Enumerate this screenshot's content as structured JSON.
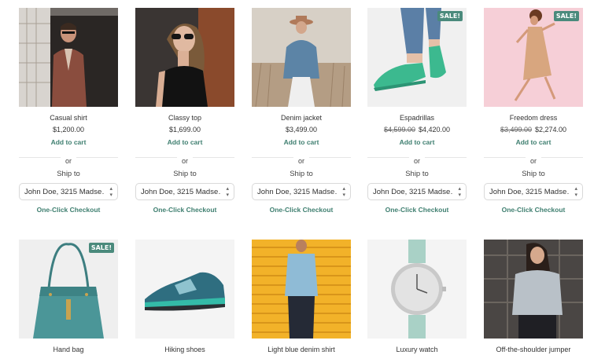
{
  "products": [
    {
      "title": "Casual shirt",
      "price": "$1,200.00",
      "old_price": "",
      "sale": false,
      "add_to_cart": "Add to cart",
      "or": "or",
      "ship_to": "Ship to",
      "address": "John Doe, 3215 Madse…",
      "checkout": "One-Click Checkout"
    },
    {
      "title": "Classy top",
      "price": "$1,699.00",
      "old_price": "",
      "sale": false,
      "add_to_cart": "Add to cart",
      "or": "or",
      "ship_to": "Ship to",
      "address": "John Doe, 3215 Madse…",
      "checkout": "One-Click Checkout"
    },
    {
      "title": "Denim jacket",
      "price": "$3,499.00",
      "old_price": "",
      "sale": false,
      "add_to_cart": "Add to cart",
      "or": "or",
      "ship_to": "Ship to",
      "address": "John Doe, 3215 Madse…",
      "checkout": "One-Click Checkout"
    },
    {
      "title": "Espadrillas",
      "price": "$4,420.00",
      "old_price": "$4,599.00",
      "sale": true,
      "sale_label": "SALE!",
      "add_to_cart": "Add to cart",
      "or": "or",
      "ship_to": "Ship to",
      "address": "John Doe, 3215 Madse…",
      "checkout": "One-Click Checkout"
    },
    {
      "title": "Freedom dress",
      "price": "$2,274.00",
      "old_price": "$3,499.00",
      "sale": true,
      "sale_label": "SALE!",
      "add_to_cart": "Add to cart",
      "or": "or",
      "ship_to": "Ship to",
      "address": "John Doe, 3215 Madse…",
      "checkout": "One-Click Checkout"
    }
  ],
  "products_row2": [
    {
      "title": "Hand bag",
      "sale": true,
      "sale_label": "SALE!"
    },
    {
      "title": "Hiking shoes",
      "sale": false
    },
    {
      "title": "Light blue denim shirt",
      "sale": false
    },
    {
      "title": "Luxury watch",
      "sale": false
    },
    {
      "title": "Off-the-shoulder jumper",
      "sale": false
    }
  ],
  "colors": {
    "accent": "#3f7f70",
    "sale_badge": "#4a8a7c"
  }
}
